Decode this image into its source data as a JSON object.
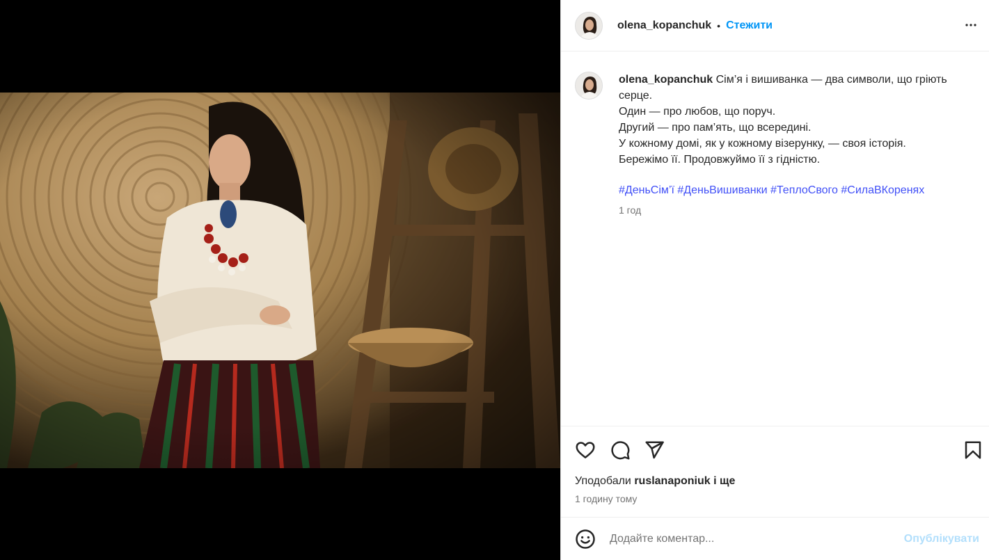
{
  "post": {
    "username": "olena_kopanchuk",
    "separator": "•",
    "follow_label": "Стежити",
    "more_icon": "more-horizontal-icon"
  },
  "caption": {
    "username": "olena_kopanchuk",
    "lines": [
      "Сім’я і вишиванка — два символи, що гріють серце.",
      "Один — про любов, що поруч.",
      "Другий — про пам’ять, що всередині.",
      "У кожному домі, як у кожному візерунку, — своя історія.",
      "Бережімо її. Продовжуймо її з гідністю."
    ],
    "hashtags": [
      "#ДеньСім’ї",
      "#ДеньВишиванки",
      "#ТеплоСвого",
      "#СилаВКоренях"
    ],
    "time": "1 год"
  },
  "actions": {
    "like_icon": "heart-icon",
    "comment_icon": "comment-icon",
    "share_icon": "send-icon",
    "save_icon": "bookmark-icon"
  },
  "likes": {
    "prefix": "Уподобали",
    "user": "ruslanaponiuk",
    "suffix": "і ще"
  },
  "time_ago": "1 годину тому",
  "comment": {
    "emoji_icon": "emoji-icon",
    "placeholder": "Додайте коментар...",
    "publish_label": "Опублікувати"
  },
  "colors": {
    "link": "#0095f6",
    "hashtag": "#4150f7",
    "publish_disabled": "#b2dffc",
    "muted": "#737373"
  }
}
